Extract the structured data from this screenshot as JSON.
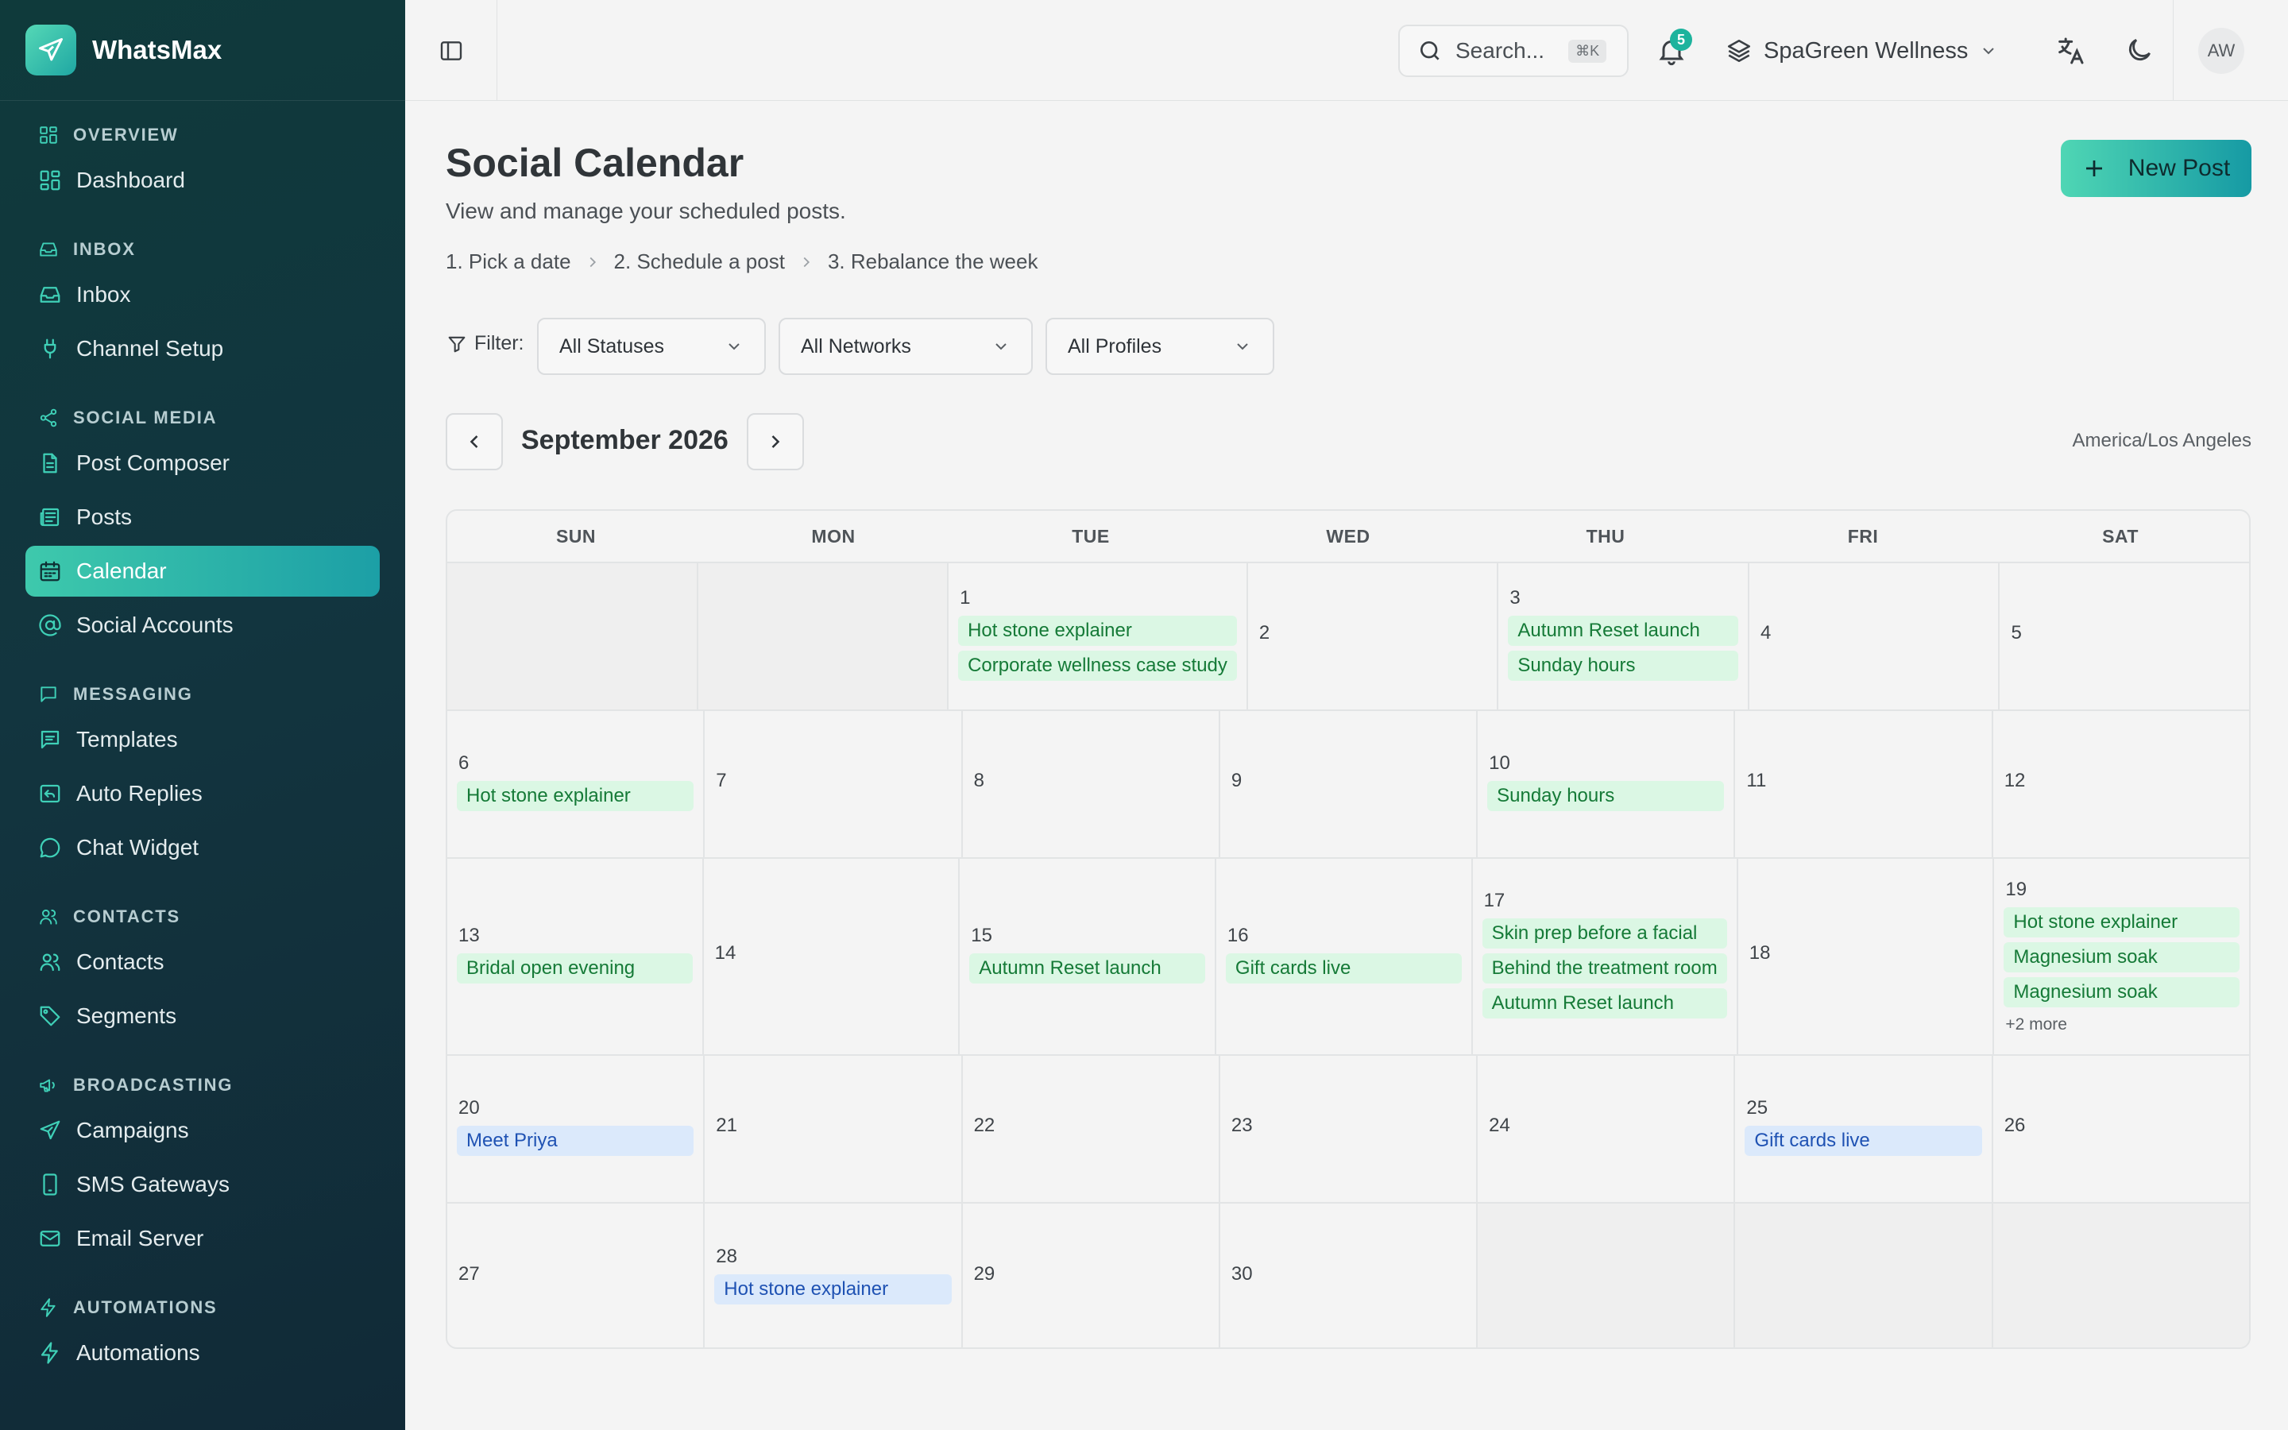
{
  "app": {
    "name": "WhatsMax"
  },
  "sidebar": {
    "sections": [
      {
        "label": "OVERVIEW",
        "icon": "grid-icon",
        "items": [
          {
            "label": "Dashboard",
            "icon": "dashboard-icon"
          }
        ]
      },
      {
        "label": "INBOX",
        "icon": "inbox-icon",
        "items": [
          {
            "label": "Inbox",
            "icon": "inbox-icon"
          },
          {
            "label": "Channel Setup",
            "icon": "plug-icon"
          }
        ]
      },
      {
        "label": "SOCIAL MEDIA",
        "icon": "share-icon",
        "items": [
          {
            "label": "Post Composer",
            "icon": "document-icon"
          },
          {
            "label": "Posts",
            "icon": "newspaper-icon"
          },
          {
            "label": "Calendar",
            "icon": "calendar-icon",
            "active": true
          },
          {
            "label": "Social Accounts",
            "icon": "at-sign-icon"
          }
        ]
      },
      {
        "label": "MESSAGING",
        "icon": "message-icon",
        "items": [
          {
            "label": "Templates",
            "icon": "message-square-text-icon"
          },
          {
            "label": "Auto Replies",
            "icon": "reply-icon"
          },
          {
            "label": "Chat Widget",
            "icon": "chat-bubble-icon"
          }
        ]
      },
      {
        "label": "CONTACTS",
        "icon": "users-icon",
        "items": [
          {
            "label": "Contacts",
            "icon": "users-icon"
          },
          {
            "label": "Segments",
            "icon": "tag-icon"
          }
        ]
      },
      {
        "label": "BROADCASTING",
        "icon": "megaphone-icon",
        "items": [
          {
            "label": "Campaigns",
            "icon": "send-icon"
          },
          {
            "label": "SMS Gateways",
            "icon": "smartphone-icon"
          },
          {
            "label": "Email Server",
            "icon": "mail-icon"
          }
        ]
      },
      {
        "label": "AUTOMATIONS",
        "icon": "zap-icon",
        "items": [
          {
            "label": "Automations",
            "icon": "zap-icon"
          }
        ]
      }
    ]
  },
  "header": {
    "search_placeholder": "Search...",
    "search_shortcut": "⌘K",
    "notification_count": "5",
    "workspace": "SpaGreen Wellness",
    "avatar_initials": "AW"
  },
  "page": {
    "title": "Social Calendar",
    "subtitle": "View and manage your scheduled posts.",
    "steps": [
      "1. Pick a date",
      "2. Schedule a post",
      "3. Rebalance the week"
    ],
    "new_post_label": "New Post"
  },
  "filters": {
    "label": "Filter:",
    "status": "All Statuses",
    "network": "All Networks",
    "profile": "All Profiles"
  },
  "calendar": {
    "month_label": "September 2026",
    "timezone": "America/Los Angeles",
    "weekdays": [
      "SUN",
      "MON",
      "TUE",
      "WED",
      "THU",
      "FRI",
      "SAT"
    ],
    "weeks": [
      [
        {
          "day": "",
          "events": []
        },
        {
          "day": "",
          "events": []
        },
        {
          "day": "1",
          "events": [
            {
              "title": "Hot stone explainer",
              "color": "green"
            },
            {
              "title": "Corporate wellness case study",
              "color": "green"
            }
          ]
        },
        {
          "day": "2",
          "events": []
        },
        {
          "day": "3",
          "events": [
            {
              "title": "Autumn Reset launch",
              "color": "green"
            },
            {
              "title": "Sunday hours",
              "color": "green"
            }
          ]
        },
        {
          "day": "4",
          "events": []
        },
        {
          "day": "5",
          "events": []
        }
      ],
      [
        {
          "day": "6",
          "events": [
            {
              "title": "Hot stone explainer",
              "color": "green"
            }
          ]
        },
        {
          "day": "7",
          "events": []
        },
        {
          "day": "8",
          "events": []
        },
        {
          "day": "9",
          "events": []
        },
        {
          "day": "10",
          "events": [
            {
              "title": "Sunday hours",
              "color": "green"
            }
          ]
        },
        {
          "day": "11",
          "events": []
        },
        {
          "day": "12",
          "events": []
        }
      ],
      [
        {
          "day": "13",
          "events": [
            {
              "title": "Bridal open evening",
              "color": "green"
            }
          ]
        },
        {
          "day": "14",
          "events": []
        },
        {
          "day": "15",
          "events": [
            {
              "title": "Autumn Reset launch",
              "color": "green"
            }
          ]
        },
        {
          "day": "16",
          "events": [
            {
              "title": "Gift cards live",
              "color": "green"
            }
          ]
        },
        {
          "day": "17",
          "events": [
            {
              "title": "Skin prep before a facial",
              "color": "green"
            },
            {
              "title": "Behind the treatment room",
              "color": "green"
            },
            {
              "title": "Autumn Reset launch",
              "color": "green"
            }
          ]
        },
        {
          "day": "18",
          "events": []
        },
        {
          "day": "19",
          "events": [
            {
              "title": "Hot stone explainer",
              "color": "green"
            },
            {
              "title": "Magnesium soak",
              "color": "green"
            },
            {
              "title": "Magnesium soak",
              "color": "green"
            }
          ],
          "more": "+2 more"
        }
      ],
      [
        {
          "day": "20",
          "events": [
            {
              "title": "Meet Priya",
              "color": "blue"
            }
          ]
        },
        {
          "day": "21",
          "events": []
        },
        {
          "day": "22",
          "events": []
        },
        {
          "day": "23",
          "events": []
        },
        {
          "day": "24",
          "events": []
        },
        {
          "day": "25",
          "events": [
            {
              "title": "Gift cards live",
              "color": "blue"
            }
          ]
        },
        {
          "day": "26",
          "events": []
        }
      ],
      [
        {
          "day": "27",
          "events": []
        },
        {
          "day": "28",
          "events": [
            {
              "title": "Hot stone explainer",
              "color": "blue"
            }
          ]
        },
        {
          "day": "29",
          "events": []
        },
        {
          "day": "30",
          "events": []
        },
        {
          "day": "",
          "events": []
        },
        {
          "day": "",
          "events": []
        },
        {
          "day": "",
          "events": []
        }
      ]
    ]
  },
  "colors": {
    "accent": "#1fa7a3",
    "event_green_bg": "#dbf7e4",
    "event_green_text": "#157a37",
    "event_blue_bg": "#dbe9fb",
    "event_blue_text": "#1f52b3"
  }
}
